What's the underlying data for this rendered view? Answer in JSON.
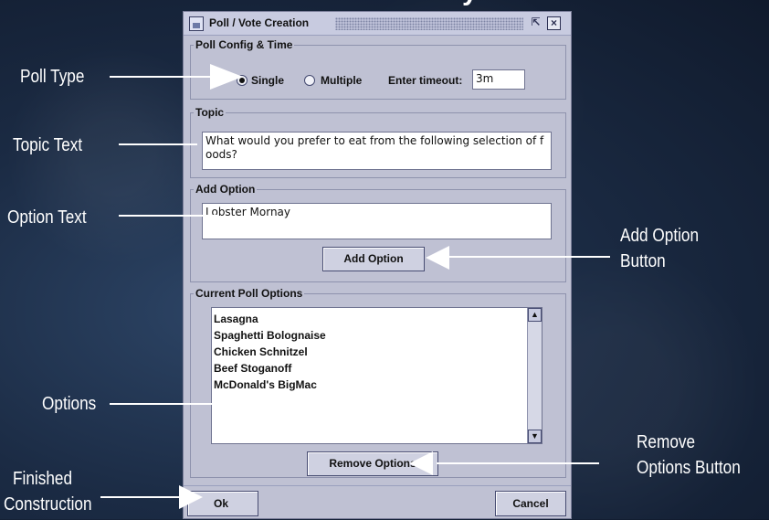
{
  "window": {
    "title": "Poll / Vote Creation",
    "restore_icon": "restore-icon",
    "close_icon": "close-icon"
  },
  "config": {
    "label": "Poll Config & Time",
    "single_label": "Single",
    "multiple_label": "Multiple",
    "selected": "Single",
    "timeout_label": "Enter timeout:",
    "timeout_value": "3m"
  },
  "topic": {
    "label": "Topic",
    "value": "What would you prefer to eat from the following selection of foods?"
  },
  "add_option": {
    "label": "Add Option",
    "value": "Lobster Mornay",
    "button_label": "Add Option"
  },
  "current_options": {
    "label": "Current Poll Options",
    "items": [
      "Lasagna",
      "Spaghetti Bolognaise",
      "Chicken Schnitzel",
      "Beef Stoganoff",
      "McDonald's BigMac"
    ],
    "remove_button_label": "Remove Options"
  },
  "footer": {
    "ok_label": "Ok",
    "cancel_label": "Cancel"
  },
  "annotations": {
    "poll_type": "Poll Type",
    "topic_text": "Topic Text",
    "option_text": "Option Text",
    "add_option_button_1": "Add Option",
    "add_option_button_2": "Button",
    "options": "Options",
    "remove_options_button_1": "Remove",
    "remove_options_button_2": "Options Button",
    "finished_construction_1": "Finished",
    "finished_construction_2": "Construction"
  },
  "colors": {
    "background": "#1b2b44",
    "window_bg": "#bfc1d3",
    "callout_text": "#ffffff"
  }
}
